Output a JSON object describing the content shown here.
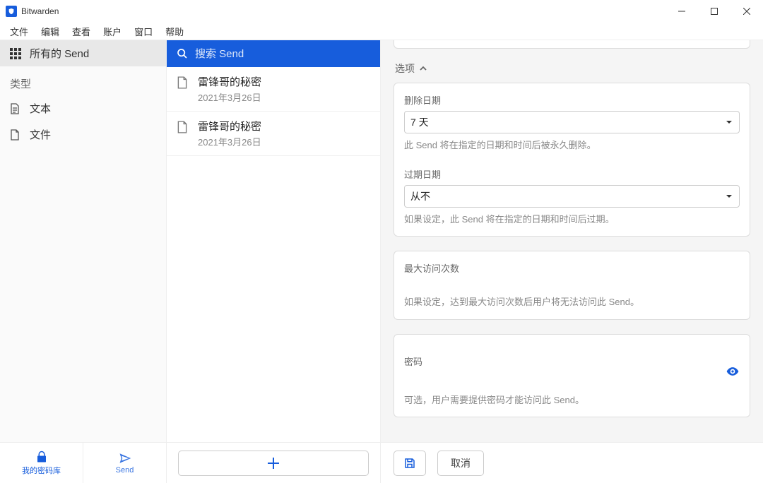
{
  "window": {
    "title": "Bitwarden"
  },
  "menu": {
    "file": "文件",
    "edit": "编辑",
    "view": "查看",
    "account": "账户",
    "window": "窗口",
    "help": "帮助"
  },
  "sidebar": {
    "all_send": "所有的 Send",
    "type_label": "类型",
    "text": "文本",
    "file": "文件"
  },
  "search": {
    "placeholder": "搜索 Send"
  },
  "items": [
    {
      "name": "雷锋哥的秘密",
      "date": "2021年3月26日"
    },
    {
      "name": "雷锋哥的秘密",
      "date": "2021年3月26日"
    }
  ],
  "options": {
    "heading": "选项",
    "delete_date": {
      "label": "删除日期",
      "value": "7 天",
      "help": "此 Send 将在指定的日期和时间后被永久删除。"
    },
    "expire_date": {
      "label": "过期日期",
      "value": "从不",
      "help": "如果设定，此 Send 将在指定的日期和时间后过期。"
    },
    "max_access": {
      "label": "最大访问次数",
      "help": "如果设定，达到最大访问次数后用户将无法访问此 Send。"
    },
    "password": {
      "label": "密码",
      "help": "可选，用户需要提供密码才能访问此 Send。"
    }
  },
  "bottom": {
    "vault": "我的密码库",
    "send": "Send",
    "cancel": "取消"
  }
}
